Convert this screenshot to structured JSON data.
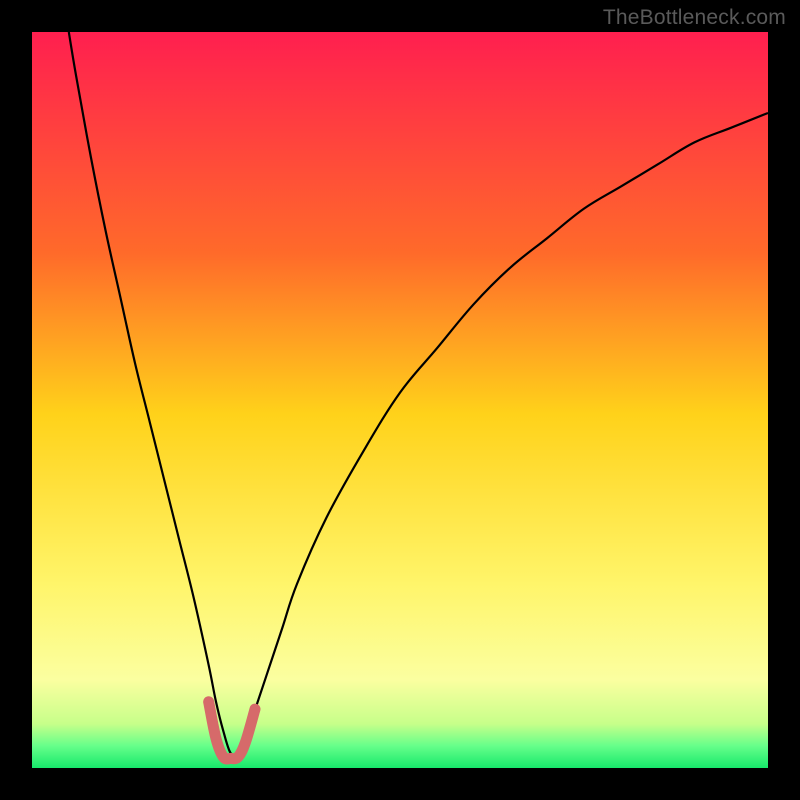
{
  "watermark": "TheBottleneck.com",
  "chart_data": {
    "type": "line",
    "title": "",
    "xlabel": "",
    "ylabel": "",
    "xlim": [
      0,
      100
    ],
    "ylim": [
      0,
      100
    ],
    "gradient_stops": [
      {
        "offset": 0,
        "color": "#ff1f4f"
      },
      {
        "offset": 0.3,
        "color": "#ff6a2a"
      },
      {
        "offset": 0.52,
        "color": "#ffd21a"
      },
      {
        "offset": 0.75,
        "color": "#fff56a"
      },
      {
        "offset": 0.88,
        "color": "#fbffa0"
      },
      {
        "offset": 0.94,
        "color": "#c7ff8a"
      },
      {
        "offset": 0.97,
        "color": "#66ff8a"
      },
      {
        "offset": 1.0,
        "color": "#17e86b"
      }
    ],
    "series": [
      {
        "name": "bottleneck-curve",
        "stroke": "#000000",
        "stroke_width": 2.2,
        "x": [
          5,
          6,
          8,
          10,
          12,
          14,
          16,
          18,
          20,
          22,
          24,
          25,
          26,
          27,
          28,
          29,
          30,
          32,
          34,
          36,
          40,
          45,
          50,
          55,
          60,
          65,
          70,
          75,
          80,
          85,
          90,
          95,
          100
        ],
        "y": [
          100,
          94,
          83,
          73,
          64,
          55,
          47,
          39,
          31,
          23,
          14,
          9,
          5,
          2,
          2,
          4,
          7,
          13,
          19,
          25,
          34,
          43,
          51,
          57,
          63,
          68,
          72,
          76,
          79,
          82,
          85,
          87,
          89
        ]
      },
      {
        "name": "highlight-min",
        "stroke": "#d66a6a",
        "stroke_width": 11,
        "linecap": "round",
        "x": [
          24.0,
          25.0,
          26.0,
          27.0,
          28.0,
          29.0,
          30.3
        ],
        "y": [
          9.0,
          4.0,
          1.5,
          1.3,
          1.5,
          3.5,
          8.0
        ]
      }
    ]
  }
}
